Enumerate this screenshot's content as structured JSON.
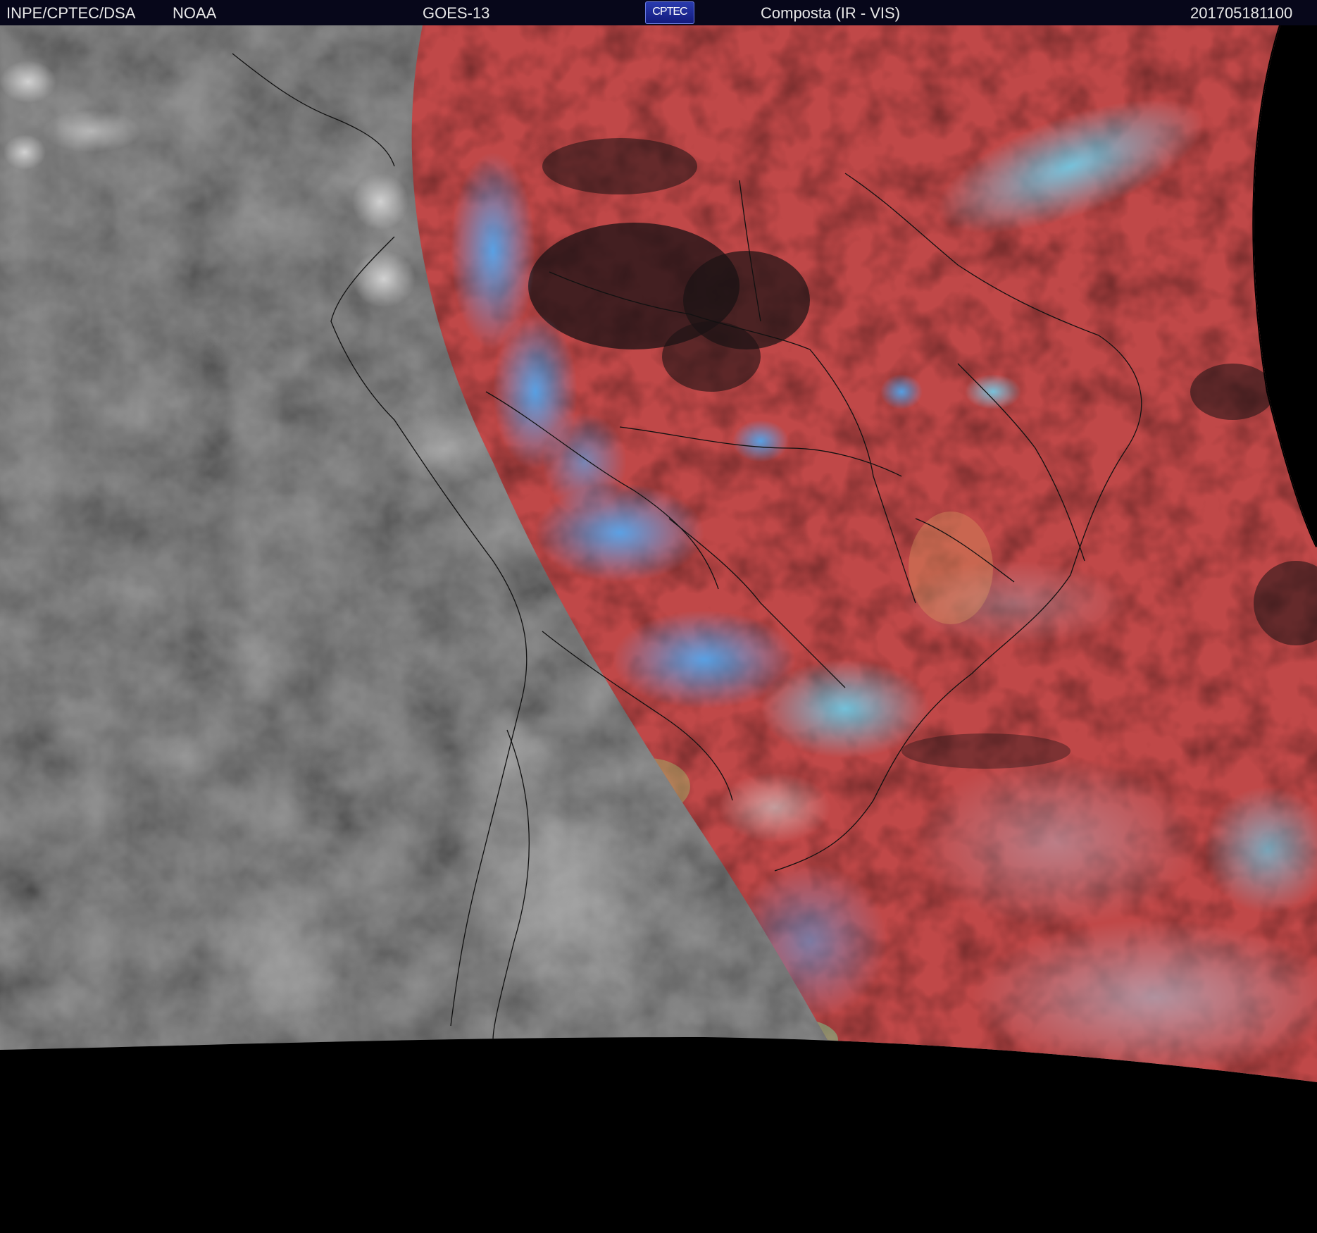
{
  "header": {
    "agency": "INPE/CPTEC/DSA",
    "partner": "NOAA",
    "satellite": "GOES-13",
    "logo_text": "CPTEC",
    "product": "Composta (IR - VIS)",
    "timestamp": "201705181100"
  },
  "colors": {
    "header_bg": "#07071a",
    "night_ir": "#3c3c3c",
    "day_composite": "#c44848",
    "clouds_high": "#3a8ef0",
    "no_data": "#000000"
  }
}
